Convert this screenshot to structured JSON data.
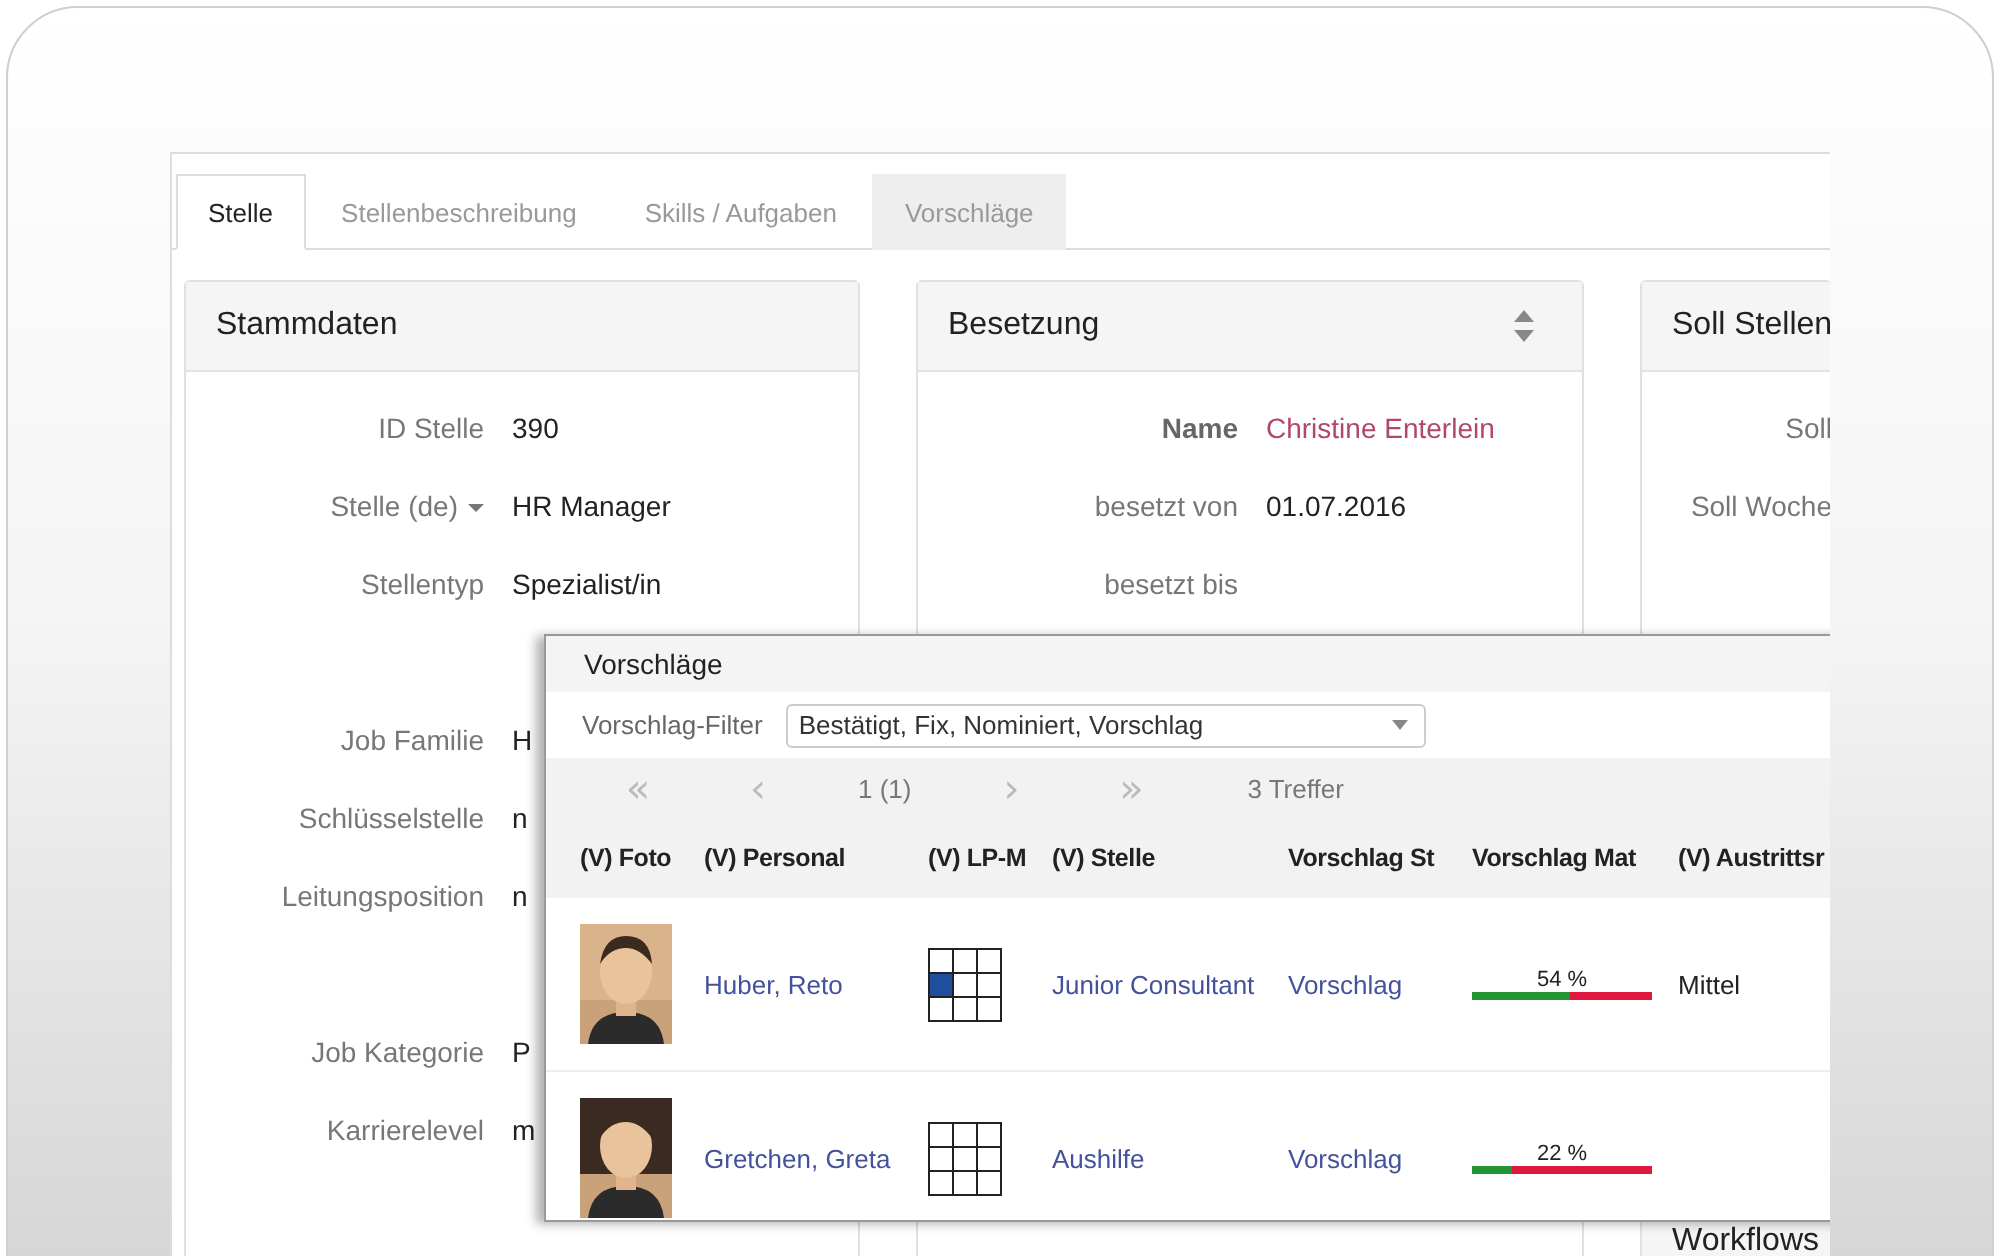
{
  "tabs": [
    {
      "label": "Stelle",
      "selected": true,
      "highlighted": false
    },
    {
      "label": "Stellenbeschreibung",
      "selected": false,
      "highlighted": false
    },
    {
      "label": "Skills / Aufgaben",
      "selected": false,
      "highlighted": false
    },
    {
      "label": "Vorschläge",
      "selected": false,
      "highlighted": true
    }
  ],
  "panels": [
    {
      "title": "Stammdaten",
      "sortable": false,
      "rows": [
        {
          "label": "ID Stelle",
          "value": "390",
          "dropdown": false,
          "gap_before": false
        },
        {
          "label": "Stelle (de)",
          "value": "HR Manager",
          "dropdown": true,
          "gap_before": false
        },
        {
          "label": "Stellentyp",
          "value": "Spezialist/in",
          "dropdown": false,
          "gap_before": false
        },
        {
          "label": "Job Familie",
          "value": "H",
          "dropdown": false,
          "gap_before": true
        },
        {
          "label": "Schlüsselstelle",
          "value": "n",
          "dropdown": false,
          "gap_before": false
        },
        {
          "label": "Leitungsposition",
          "value": "n",
          "dropdown": false,
          "gap_before": false
        },
        {
          "label": "Job Kategorie",
          "value": "P",
          "dropdown": false,
          "gap_before": true
        },
        {
          "label": "Karrierelevel",
          "value": "m",
          "dropdown": false,
          "gap_before": false
        }
      ]
    },
    {
      "title": "Besetzung",
      "sortable": true,
      "rows": [
        {
          "label": "Name",
          "value": "Christine Enterlein",
          "kind": "link",
          "bold_label": true
        },
        {
          "label": "besetzt von",
          "value": "01.07.2016",
          "kind": "text",
          "bold_label": false
        },
        {
          "label": "besetzt bis",
          "bold_label": false
        }
      ]
    },
    {
      "title": "Soll Stellen",
      "rows": [
        {
          "label": "Soll"
        },
        {
          "label": "Soll Woche"
        }
      ]
    },
    {
      "title": "Workflows"
    }
  ],
  "dialog": {
    "title": "Vorschläge",
    "filter": {
      "label": "Vorschlag-Filter",
      "value": "Bestätigt, Fix, Nominiert, Vorschlag"
    },
    "pager": {
      "first": "«",
      "prev": "‹",
      "page": "1 (1)",
      "next": "›",
      "last": "»",
      "count": "3 Treffer"
    },
    "columns": [
      "(V) Foto",
      "(V) Personal",
      "(V) LP-M",
      "(V) Stelle",
      "Vorschlag St",
      "Vorschlag Mat",
      "(V) Austrittsr"
    ],
    "rows": [
      {
        "name": "Huber, Reto",
        "lp_matrix": [
          {
            "filled": false
          },
          {
            "filled": false
          },
          {
            "filled": false
          },
          {
            "filled": true
          },
          {
            "filled": false
          },
          {
            "filled": false
          },
          {
            "filled": false
          },
          {
            "filled": false
          },
          {
            "filled": false
          }
        ],
        "stelle": "Junior Consultant",
        "status": "Vorschlag",
        "match": "54 %",
        "level": 0.54,
        "austritt": "Mittel"
      },
      {
        "name": "Gretchen, Greta",
        "lp_matrix": [
          {
            "filled": false
          },
          {
            "filled": false
          },
          {
            "filled": false
          },
          {
            "filled": false
          },
          {
            "filled": false
          },
          {
            "filled": false
          },
          {
            "filled": false
          },
          {
            "filled": false
          },
          {
            "filled": false
          }
        ],
        "stelle": "Aushilfe",
        "status": "Vorschlag",
        "match": "22 %",
        "level": 0.22
      }
    ]
  }
}
